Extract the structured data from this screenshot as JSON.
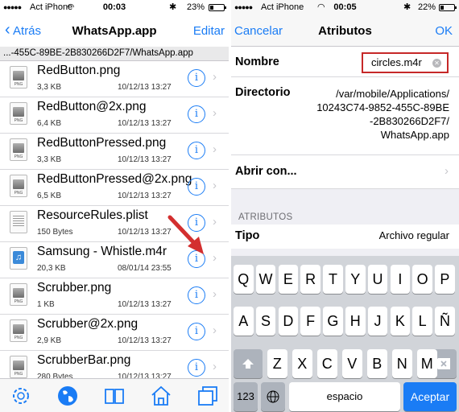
{
  "left": {
    "status": {
      "carrier": "Act iPhone",
      "time": "00:03",
      "battery": "23%",
      "battery_level": 0.23
    },
    "nav": {
      "back_label": "Atrás",
      "title": "WhatsApp.app",
      "edit_label": "Editar"
    },
    "path": "...-455C-89BE-2B830266D2F7/WhatsApp.app",
    "files": [
      {
        "name": "RedButton.png",
        "size": "3,3 KB",
        "date": "10/12/13 13:27",
        "icon": "image-file-icon"
      },
      {
        "name": "RedButton@2x.png",
        "size": "6,4 KB",
        "date": "10/12/13 13:27",
        "icon": "image-file-icon"
      },
      {
        "name": "RedButtonPressed.png",
        "size": "3,3 KB",
        "date": "10/12/13 13:27",
        "icon": "image-file-icon"
      },
      {
        "name": "RedButtonPressed@2x.png",
        "size": "6,5 KB",
        "date": "10/12/13 13:27",
        "icon": "image-file-icon"
      },
      {
        "name": "ResourceRules.plist",
        "size": "150 Bytes",
        "date": "10/12/13 13:27",
        "icon": "document-file-icon"
      },
      {
        "name": "Samsung - Whistle.m4r",
        "size": "20,3 KB",
        "date": "08/01/14 23:55",
        "icon": "audio-file-icon"
      },
      {
        "name": "Scrubber.png",
        "size": "1 KB",
        "date": "10/12/13 13:27",
        "icon": "image-file-icon"
      },
      {
        "name": "Scrubber@2x.png",
        "size": "2,9 KB",
        "date": "10/12/13 13:27",
        "icon": "image-file-icon"
      },
      {
        "name": "ScrubberBar.png",
        "size": "280 Bytes",
        "date": "10/12/13 13:27",
        "icon": "image-file-icon"
      }
    ],
    "tabs": [
      "gear-icon",
      "globe-icon",
      "book-icon",
      "home-icon",
      "windows-icon"
    ]
  },
  "right": {
    "status": {
      "carrier": "Act iPhone",
      "time": "00:05",
      "battery": "22%",
      "battery_level": 0.22
    },
    "nav": {
      "cancel_label": "Cancelar",
      "title": "Atributos",
      "ok_label": "OK"
    },
    "name_label": "Nombre",
    "name_value": "circles.m4r",
    "dir_label": "Directorio",
    "dir_lines": [
      "/var/mobile/Applications/",
      "10243C74-9852-455C-89BE",
      "-2B830266D2F7/",
      "WhatsApp.app"
    ],
    "open_with_label": "Abrir con...",
    "section_title": "ATRIBUTOS",
    "type_label": "Tipo",
    "type_value": "Archivo regular",
    "keyboard": {
      "row1": [
        "Q",
        "W",
        "E",
        "R",
        "T",
        "Y",
        "U",
        "I",
        "O",
        "P"
      ],
      "row2": [
        "A",
        "S",
        "D",
        "F",
        "G",
        "H",
        "J",
        "K",
        "L",
        "Ñ"
      ],
      "row3": [
        "Z",
        "X",
        "C",
        "V",
        "B",
        "N",
        "M"
      ],
      "numbers_key": "123",
      "space_key": "espacio",
      "accept_key": "Aceptar"
    }
  },
  "colors": {
    "accent": "#1a7cf5",
    "highlight_box": "#c62828",
    "arrow": "#d32f2f"
  }
}
